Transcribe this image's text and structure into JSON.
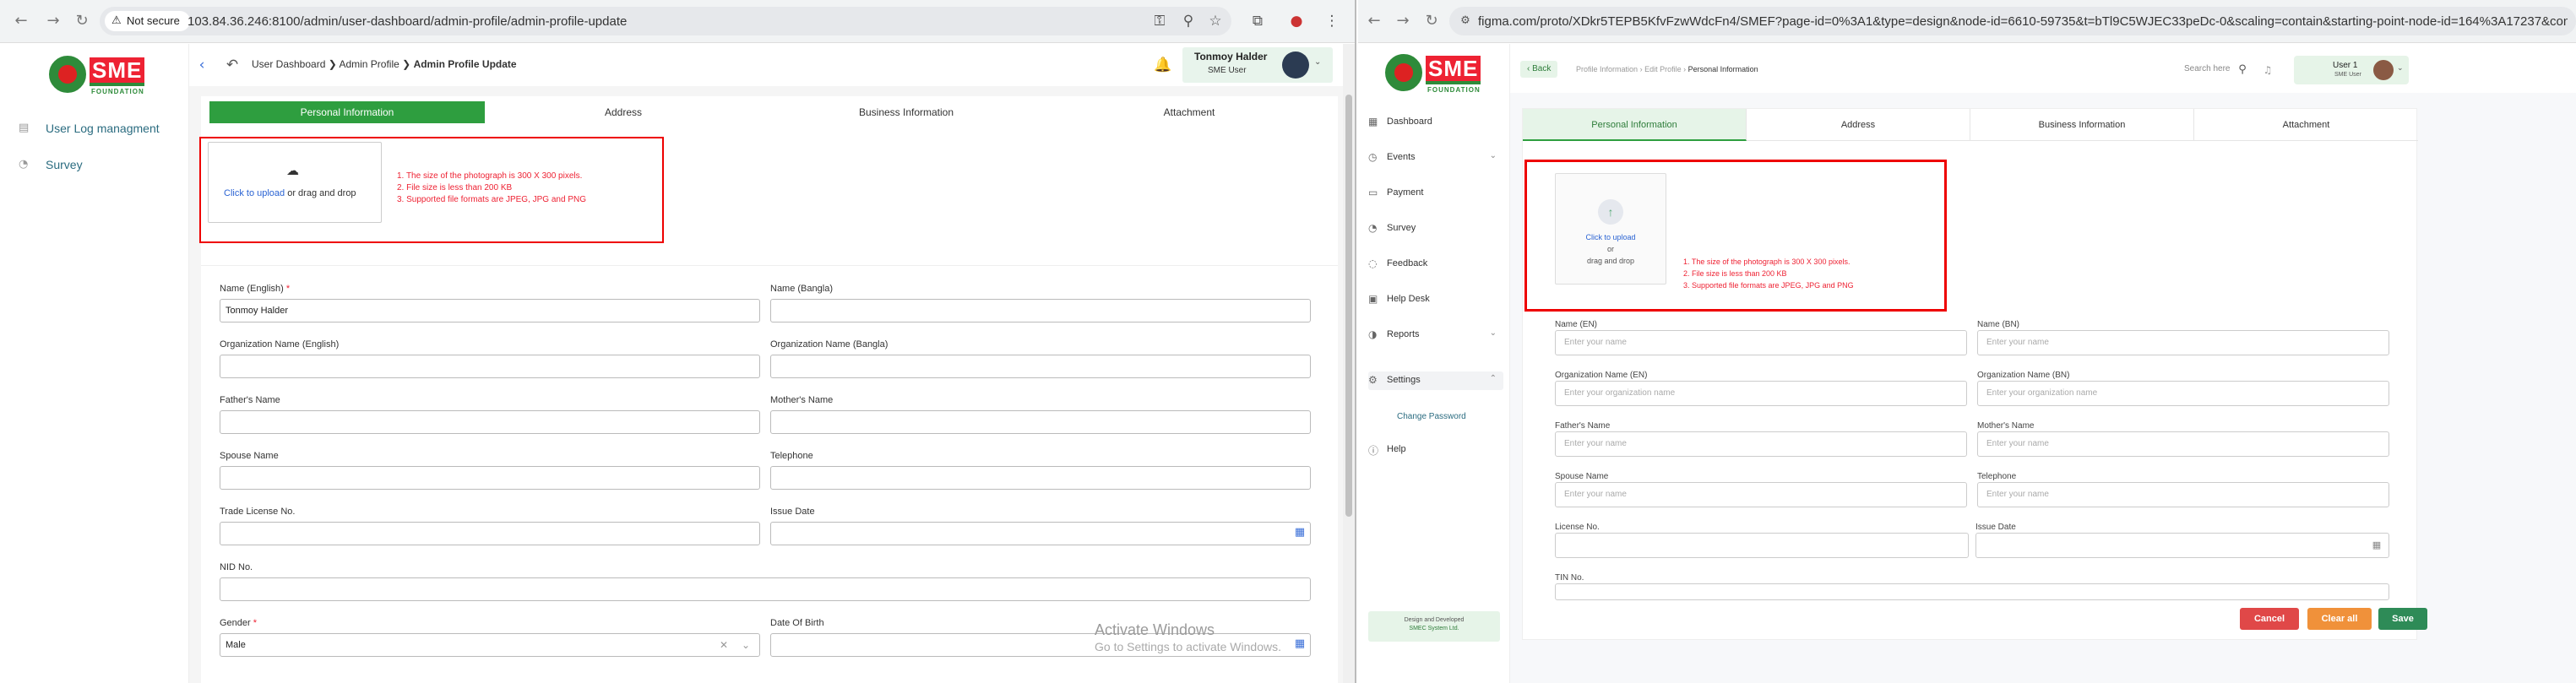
{
  "left_browser": {
    "security_chip": "Not secure",
    "url": "103.84.36.246:8100/admin/user-dashboard/admin-profile/admin-profile-update"
  },
  "right_browser": {
    "url": "figma.com/proto/XDkr5TEPB5KfvFzwWdcFn4/SMEF?page-id=0%3A1&type=design&node-id=6610-59735&t=bTl9C5WJEC33peDc-0&scaling=contain&starting-point-node-id=164%3A17237&cont..."
  },
  "left_app": {
    "logo": {
      "text": "SME",
      "sub": "FOUNDATION"
    },
    "sidebar": [
      {
        "label": "User Log managment",
        "icon": "document-icon"
      },
      {
        "label": "Survey",
        "icon": "survey-icon"
      }
    ],
    "breadcrumb": {
      "item1": "User Dashboard",
      "item2": "Admin Profile",
      "current": "Admin Profile Update"
    },
    "user": {
      "name": "Tonmoy Halder",
      "role": "SME User"
    },
    "tabs": [
      "Personal Information",
      "Address",
      "Business Information",
      "Attachment"
    ],
    "upload": {
      "link": "Click to upload",
      "rest": "or drag and drop",
      "rules": [
        "1. The size of the photograph is 300 X 300 pixels.",
        "2. File size is less than 200 KB",
        "3. Supported file formats are JPEG, JPG and PNG"
      ]
    },
    "fields": {
      "name_en": {
        "label": "Name (English)",
        "required": "*",
        "value": "Tonmoy Halder"
      },
      "name_bn": {
        "label": "Name (Bangla)",
        "value": ""
      },
      "org_en": {
        "label": "Organization Name (English)",
        "value": ""
      },
      "org_bn": {
        "label": "Organization Name (Bangla)",
        "value": ""
      },
      "father": {
        "label": "Father's Name",
        "value": ""
      },
      "mother": {
        "label": "Mother's Name",
        "value": ""
      },
      "spouse": {
        "label": "Spouse Name",
        "value": ""
      },
      "telephone": {
        "label": "Telephone",
        "value": ""
      },
      "trade": {
        "label": "Trade License No.",
        "value": ""
      },
      "issue": {
        "label": "Issue Date",
        "value": ""
      },
      "nid": {
        "label": "NID No.",
        "value": ""
      },
      "gender": {
        "label": "Gender",
        "required": "*",
        "value": "Male"
      },
      "dob": {
        "label": "Date Of Birth",
        "value": ""
      }
    },
    "watermark": {
      "title": "Activate Windows",
      "sub": "Go to Settings to activate Windows."
    }
  },
  "right_app": {
    "logo": {
      "text": "SME",
      "sub": "FOUNDATION"
    },
    "back": "Back",
    "breadcrumb": [
      "Profile Information",
      "Edit Profile",
      "Personal Information"
    ],
    "search": "Search here",
    "user": {
      "name": "User 1",
      "role": "SME User"
    },
    "sidebar": [
      {
        "label": "Dashboard",
        "icon": "grid-icon",
        "chev": ""
      },
      {
        "label": "Events",
        "icon": "calendar-icon",
        "chev": "⌄"
      },
      {
        "label": "Payment",
        "icon": "payment-icon",
        "chev": ""
      },
      {
        "label": "Survey",
        "icon": "survey-icon",
        "chev": ""
      },
      {
        "label": "Feedback",
        "icon": "feedback-icon",
        "chev": ""
      },
      {
        "label": "Help Desk",
        "icon": "helpdesk-icon",
        "chev": ""
      },
      {
        "label": "Reports",
        "icon": "report-icon",
        "chev": "⌄"
      },
      {
        "label": "Settings",
        "icon": "gear-icon",
        "chev": "⌃"
      },
      {
        "label": "Help",
        "icon": "help-icon",
        "chev": ""
      }
    ],
    "submenu": "Change Password",
    "footer": {
      "line1": "Design and Developed",
      "line2": "SMEC System Ltd."
    },
    "tabs": [
      "Personal Information",
      "Address",
      "Business Information",
      "Attachment"
    ],
    "upload": {
      "link": "Click to upload",
      "or": "or",
      "rest": "drag and drop",
      "rules": [
        "1. The size of the photograph is 300 X 300 pixels.",
        "2. File size is less than 200 KB",
        "3. Supported file formats are JPEG, JPG and PNG"
      ]
    },
    "fields": {
      "name_en": {
        "label": "Name (EN)",
        "placeholder": "Enter your name"
      },
      "name_bn": {
        "label": "Name (BN)",
        "placeholder": "Enter your name"
      },
      "org_en": {
        "label": "Organization Name (EN)",
        "placeholder": "Enter your organization name"
      },
      "org_bn": {
        "label": "Organization Name (BN)",
        "placeholder": "Enter your organization name"
      },
      "father": {
        "label": "Father's Name",
        "placeholder": "Enter your name"
      },
      "mother": {
        "label": "Mother's Name",
        "placeholder": "Enter your name"
      },
      "spouse": {
        "label": "Spouse Name",
        "placeholder": "Enter your name"
      },
      "telephone": {
        "label": "Telephone",
        "placeholder": "Enter your name"
      },
      "license": {
        "label": "License No.",
        "placeholder": ""
      },
      "issue": {
        "label": "Issue Date",
        "placeholder": ""
      },
      "tin": {
        "label": "TIN No.",
        "placeholder": ""
      }
    },
    "buttons": {
      "cancel": "Cancel",
      "clear": "Clear all",
      "save": "Save"
    },
    "colors": {
      "cancel": "#e04848",
      "clear": "#f0913a",
      "save": "#2e8b57"
    }
  }
}
